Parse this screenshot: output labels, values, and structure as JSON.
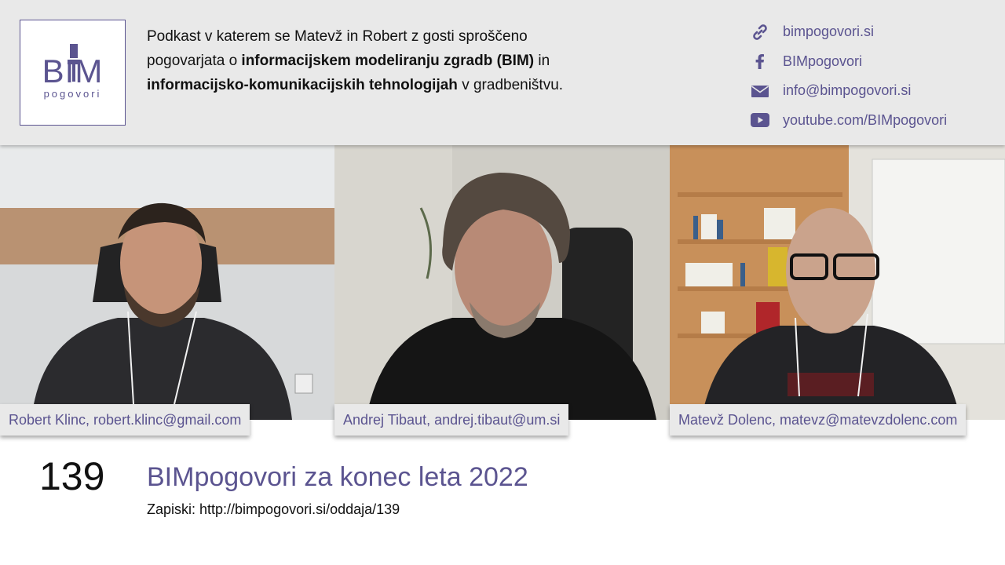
{
  "brand": {
    "logo_main": "BIM",
    "logo_sub": "pogovori",
    "accent_color": "#5b5490"
  },
  "description": {
    "part1": "Podkast v katerem se Matevž in Robert z gosti sproščeno pogovarjata o ",
    "bold1": "informacijskem modeliranju zgradb (BIM)",
    "part2": " in ",
    "bold2": "informacijsko-komunikacijskih tehnologijah",
    "part3": " v gradbeništvu."
  },
  "links": [
    {
      "icon": "link-icon",
      "text": "bimpogovori.si"
    },
    {
      "icon": "facebook-icon",
      "text": "BIMpogovori"
    },
    {
      "icon": "mail-icon",
      "text": "info@bimpogovori.si"
    },
    {
      "icon": "youtube-icon",
      "text": "youtube.com/BIMpogovori"
    }
  ],
  "participants": [
    {
      "label": "Robert Klinc, robert.klinc@gmail.com"
    },
    {
      "label": "Andrej Tibaut, andrej.tibaut@um.si"
    },
    {
      "label": "Matevž Dolenc, matevz@matevzdolenc.com"
    }
  ],
  "episode": {
    "number": "139",
    "title": "BIMpogovori za konec leta 2022",
    "notes": "Zapiski: http://bimpogovori.si/oddaja/139"
  }
}
